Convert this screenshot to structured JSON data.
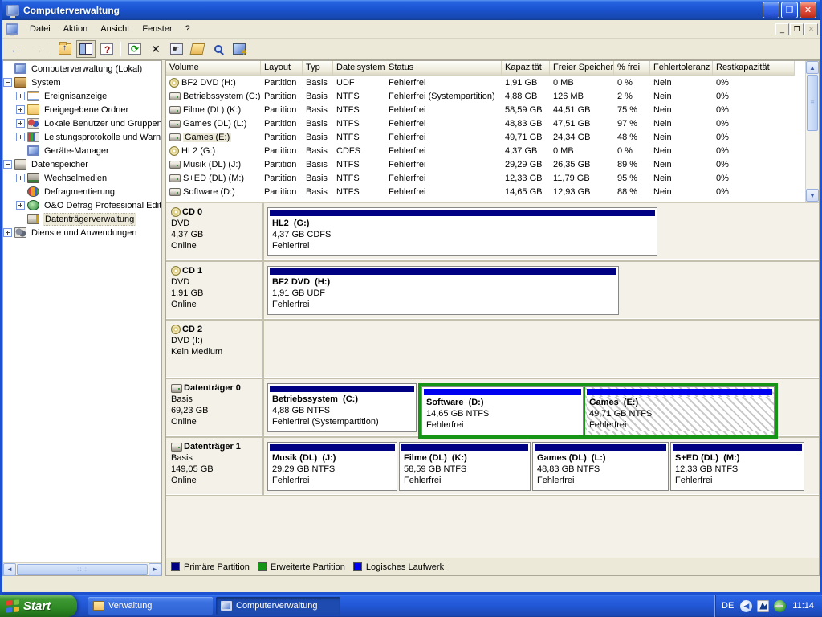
{
  "colors": {
    "title_blue": "#1b54d1",
    "frame_blue": "#1c51d2",
    "beige": "#ece9d8",
    "primary_navy": "#000082",
    "logical_blue": "#0000f0",
    "extended_green": "#169416",
    "taskbar_blue": "#2258d8",
    "start_green": "#2f8a25"
  },
  "window": {
    "title": "Computerverwaltung",
    "menus": [
      "Datei",
      "Aktion",
      "Ansicht",
      "Fenster",
      "?"
    ],
    "controls": {
      "minimize": "_",
      "restore": "❐",
      "close": "✕"
    },
    "mdi_controls": {
      "minimize": "_",
      "restore": "❐",
      "close": "✕"
    },
    "toolbar_icons": [
      "back",
      "forward",
      "up-folder",
      "show-hide-console-tree",
      "help",
      "refresh",
      "delete",
      "properties",
      "open-folder",
      "find",
      "manage-computer"
    ]
  },
  "tree": {
    "items": [
      {
        "label": "Computerverwaltung (Lokal)",
        "depth": 0,
        "expander": "none",
        "icon": "computer",
        "selected": false
      },
      {
        "label": "System",
        "depth": 1,
        "expander": "minus",
        "icon": "system",
        "selected": false
      },
      {
        "label": "Ereignisanzeige",
        "depth": 2,
        "expander": "plus",
        "icon": "log",
        "selected": false
      },
      {
        "label": "Freigegebene Ordner",
        "depth": 2,
        "expander": "plus",
        "icon": "folder",
        "selected": false
      },
      {
        "label": "Lokale Benutzer und Gruppen",
        "depth": 2,
        "expander": "plus",
        "icon": "users",
        "selected": false
      },
      {
        "label": "Leistungsprotokolle und Warnungen",
        "depth": 2,
        "expander": "plus",
        "icon": "perf",
        "selected": false
      },
      {
        "label": "Geräte-Manager",
        "depth": 2,
        "expander": "none",
        "icon": "device",
        "selected": false
      },
      {
        "label": "Datenspeicher",
        "depth": 1,
        "expander": "minus",
        "icon": "storage",
        "selected": false
      },
      {
        "label": "Wechselmedien",
        "depth": 2,
        "expander": "plus",
        "icon": "removable",
        "selected": false
      },
      {
        "label": "Defragmentierung",
        "depth": 2,
        "expander": "none",
        "icon": "defrag",
        "selected": false
      },
      {
        "label": "O&O Defrag Professional Edition",
        "depth": 2,
        "expander": "plus",
        "icon": "oo",
        "selected": false
      },
      {
        "label": "Datenträgerverwaltung",
        "depth": 2,
        "expander": "none",
        "icon": "diskmgmt",
        "selected": true
      },
      {
        "label": "Dienste und Anwendungen",
        "depth": 1,
        "expander": "plus",
        "icon": "services",
        "selected": false
      }
    ]
  },
  "volume_table": {
    "columns": [
      "Volume",
      "Layout",
      "Typ",
      "Dateisystem",
      "Status",
      "Kapazität",
      "Freier Speicher",
      "% frei",
      "Fehlertoleranz",
      "Restkapazität"
    ],
    "rows": [
      {
        "icon": "cd",
        "cells": [
          "BF2 DVD (H:)",
          "Partition",
          "Basis",
          "UDF",
          "Fehlerfrei",
          "1,91 GB",
          "0 MB",
          "0 %",
          "Nein",
          "0%"
        ]
      },
      {
        "icon": "disk",
        "cells": [
          "Betriebssystem (C:)",
          "Partition",
          "Basis",
          "NTFS",
          "Fehlerfrei (Systempartition)",
          "4,88 GB",
          "126 MB",
          "2 %",
          "Nein",
          "0%"
        ]
      },
      {
        "icon": "disk",
        "cells": [
          "Filme (DL) (K:)",
          "Partition",
          "Basis",
          "NTFS",
          "Fehlerfrei",
          "58,59 GB",
          "44,51 GB",
          "75 %",
          "Nein",
          "0%"
        ]
      },
      {
        "icon": "disk",
        "cells": [
          "Games (DL) (L:)",
          "Partition",
          "Basis",
          "NTFS",
          "Fehlerfrei",
          "48,83 GB",
          "47,51 GB",
          "97 %",
          "Nein",
          "0%"
        ]
      },
      {
        "icon": "disk",
        "selected": true,
        "cells": [
          "Games (E:)",
          "Partition",
          "Basis",
          "NTFS",
          "Fehlerfrei",
          "49,71 GB",
          "24,34 GB",
          "48 %",
          "Nein",
          "0%"
        ]
      },
      {
        "icon": "cd",
        "cells": [
          "HL2 (G:)",
          "Partition",
          "Basis",
          "CDFS",
          "Fehlerfrei",
          "4,37 GB",
          "0 MB",
          "0 %",
          "Nein",
          "0%"
        ]
      },
      {
        "icon": "disk",
        "cells": [
          "Musik (DL) (J:)",
          "Partition",
          "Basis",
          "NTFS",
          "Fehlerfrei",
          "29,29 GB",
          "26,35 GB",
          "89 %",
          "Nein",
          "0%"
        ]
      },
      {
        "icon": "disk",
        "cells": [
          "S+ED (DL) (M:)",
          "Partition",
          "Basis",
          "NTFS",
          "Fehlerfrei",
          "12,33 GB",
          "11,79 GB",
          "95 %",
          "Nein",
          "0%"
        ]
      },
      {
        "icon": "disk",
        "cells": [
          "Software (D:)",
          "Partition",
          "Basis",
          "NTFS",
          "Fehlerfrei",
          "14,65 GB",
          "12,93 GB",
          "88 %",
          "Nein",
          "0%"
        ]
      }
    ]
  },
  "graphical": {
    "devices": [
      {
        "name": "CD 0",
        "line1": "DVD",
        "line2": "4,37 GB",
        "line3": "Online",
        "volumes": [
          {
            "name": "HL2  (G:)",
            "info": "4,37 GB CDFS",
            "status": "Fehlerfrei"
          }
        ]
      },
      {
        "name": "CD 1",
        "line1": "DVD",
        "line2": "1,91 GB",
        "line3": "Online",
        "volumes": [
          {
            "name": "BF2 DVD  (H:)",
            "info": "1,91 GB UDF",
            "status": "Fehlerfrei"
          }
        ]
      },
      {
        "name": "CD 2",
        "line1": "DVD (I:)",
        "line2": "",
        "line3": "Kein Medium",
        "volumes": []
      },
      {
        "name": "Datenträger 0",
        "line1": "Basis",
        "line2": "69,23 GB",
        "line3": "Online",
        "volumes": [
          {
            "name": "Betriebssystem  (C:)",
            "info": "4,88 GB NTFS",
            "status": "Fehlerfrei (Systempartition)"
          },
          {
            "name": "Software  (D:)",
            "info": "14,65 GB NTFS",
            "status": "Fehlerfrei"
          },
          {
            "name": "Games  (E:)",
            "info": "49,71 GB NTFS",
            "status": "Fehlerfrei"
          }
        ]
      },
      {
        "name": "Datenträger 1",
        "line1": "Basis",
        "line2": "149,05 GB",
        "line3": "Online",
        "volumes": [
          {
            "name": "Musik (DL)  (J:)",
            "info": "29,29 GB NTFS",
            "status": "Fehlerfrei"
          },
          {
            "name": "Filme (DL)  (K:)",
            "info": "58,59 GB NTFS",
            "status": "Fehlerfrei"
          },
          {
            "name": "Games (DL)  (L:)",
            "info": "48,83 GB NTFS",
            "status": "Fehlerfrei"
          },
          {
            "name": "S+ED (DL)  (M:)",
            "info": "12,33 GB NTFS",
            "status": "Fehlerfrei"
          }
        ]
      }
    ]
  },
  "legend": {
    "items": [
      {
        "label": "Primäre Partition",
        "color": "#000082"
      },
      {
        "label": "Erweiterte Partition",
        "color": "#169416"
      },
      {
        "label": "Logisches Laufwerk",
        "color": "#0000f0"
      }
    ]
  },
  "taskbar": {
    "start_label": "Start",
    "tasks": [
      {
        "label": "Verwaltung",
        "active": false
      },
      {
        "label": "Computerverwaltung",
        "active": true
      }
    ],
    "tray": {
      "lang": "DE",
      "time": "11:14"
    }
  }
}
